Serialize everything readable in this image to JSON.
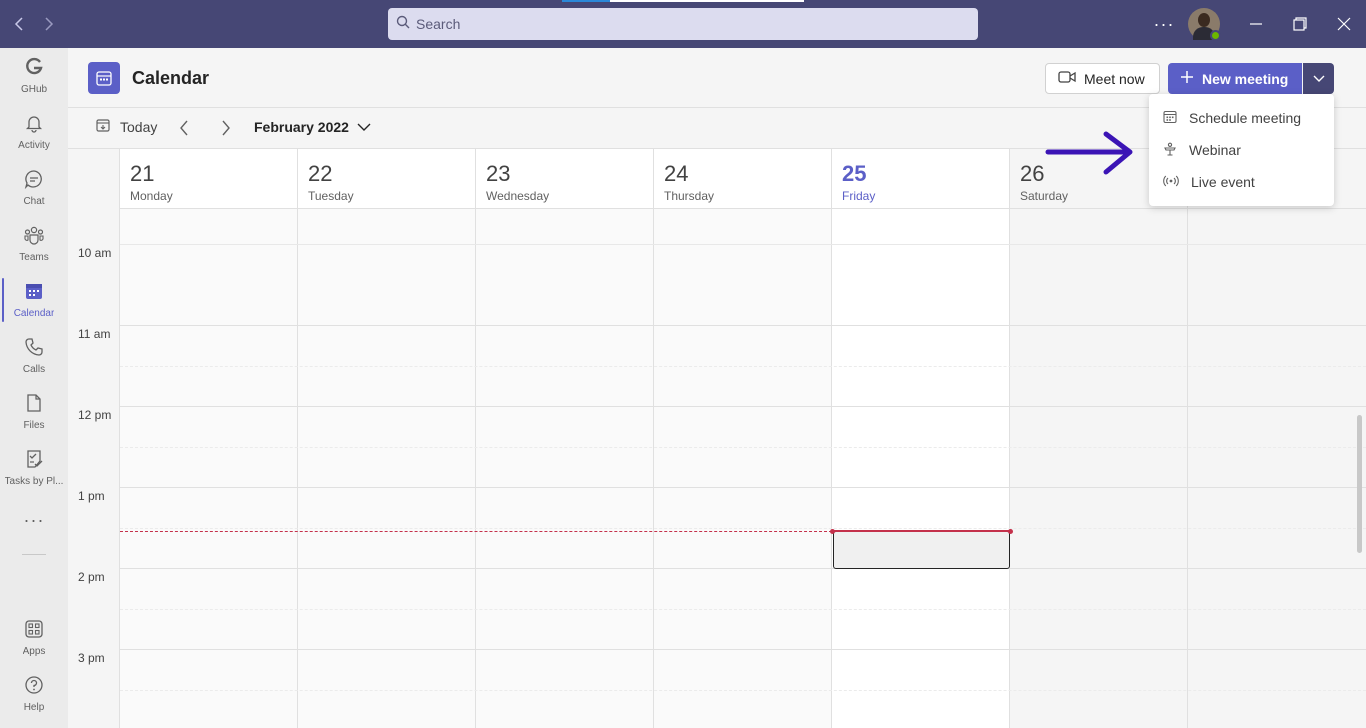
{
  "titlebar": {
    "search_placeholder": "Search",
    "more_label": "···"
  },
  "rail": {
    "items": [
      {
        "label": "GHub",
        "icon": "github-icon"
      },
      {
        "label": "Activity",
        "icon": "bell-icon"
      },
      {
        "label": "Chat",
        "icon": "chat-icon"
      },
      {
        "label": "Teams",
        "icon": "teams-icon"
      },
      {
        "label": "Calendar",
        "icon": "calendar-icon",
        "active": true
      },
      {
        "label": "Calls",
        "icon": "phone-icon"
      },
      {
        "label": "Files",
        "icon": "file-icon"
      },
      {
        "label": "Tasks by Pl...",
        "icon": "tasks-icon"
      },
      {
        "label": "Apps",
        "icon": "apps-icon"
      },
      {
        "label": "Help",
        "icon": "help-icon"
      }
    ],
    "more_label": "···"
  },
  "header": {
    "title": "Calendar",
    "meet_now": "Meet now",
    "new_meeting": "New meeting"
  },
  "toolbar": {
    "today": "Today",
    "month": "February 2022"
  },
  "calendar": {
    "days": [
      {
        "num": "21",
        "name": "Monday"
      },
      {
        "num": "22",
        "name": "Tuesday"
      },
      {
        "num": "23",
        "name": "Wednesday"
      },
      {
        "num": "24",
        "name": "Thursday"
      },
      {
        "num": "25",
        "name": "Friday",
        "today": true
      },
      {
        "num": "26",
        "name": "Saturday"
      },
      {
        "num": "",
        "name": ""
      }
    ],
    "times": [
      "10 am",
      "11 am",
      "12 pm",
      "1 pm",
      "2 pm",
      "3 pm"
    ]
  },
  "menu": {
    "items": [
      {
        "label": "Schedule meeting",
        "icon": "calendar-grid-icon"
      },
      {
        "label": "Webinar",
        "icon": "podium-icon"
      },
      {
        "label": "Live event",
        "icon": "broadcast-icon"
      }
    ]
  },
  "colors": {
    "titlebar": "#464775",
    "accent": "#5b5fc7",
    "now_line": "#c4314b",
    "annotation_arrow": "#3b14b5"
  }
}
